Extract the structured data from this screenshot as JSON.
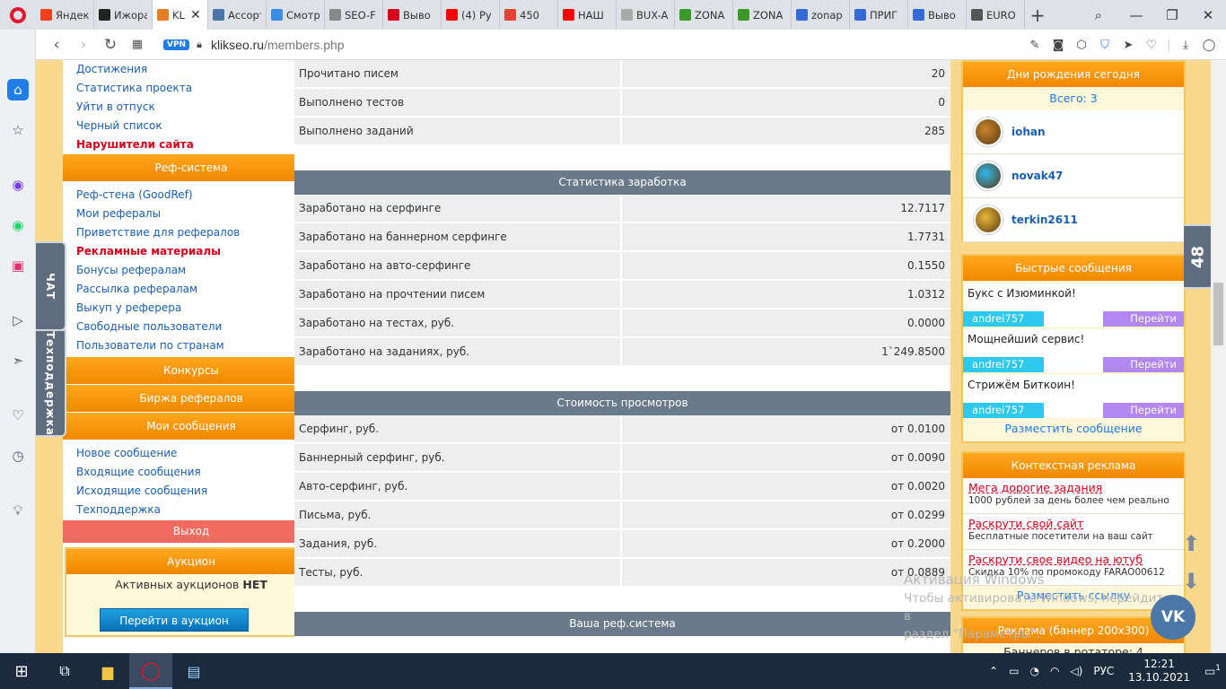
{
  "browser": {
    "tabs": [
      {
        "title": "Яндекс",
        "color": "#fc3f1d"
      },
      {
        "title": "Ижора",
        "color": "#222222"
      },
      {
        "title": "KL",
        "color": "#e67e22",
        "active": true
      },
      {
        "title": "Ассорти",
        "color": "#4a76a8"
      },
      {
        "title": "Смотр",
        "color": "#3a8de0"
      },
      {
        "title": "SEO-F",
        "color": "#888888"
      },
      {
        "title": "Выво",
        "color": "#d6001c"
      },
      {
        "title": "(4) Ру",
        "color": "#ff0000"
      },
      {
        "title": "450",
        "color": "#ef4036"
      },
      {
        "title": "НАШ",
        "color": "#ff0000"
      },
      {
        "title": "BUX-A",
        "color": "#aaaaaa"
      },
      {
        "title": "ZONA",
        "color": "#3c9a2b"
      },
      {
        "title": "ZONA",
        "color": "#3c9a2b"
      },
      {
        "title": "zonap",
        "color": "#3569d6"
      },
      {
        "title": "ПРИГ",
        "color": "#3569d6"
      },
      {
        "title": "Выво",
        "color": "#3569d6"
      },
      {
        "title": "EURO",
        "color": "#555555"
      }
    ],
    "url_host": "klikseo.ru",
    "url_path": "/members.php",
    "vpn_label": "VPN"
  },
  "left_menu": {
    "links_top": [
      "Достижения",
      "Статистика проекта",
      "Уйти в отпуск",
      "Черный список"
    ],
    "violators": "Нарушители сайта",
    "ref_header": "Реф-система",
    "ref_links": [
      "Реф-стена (GoodRef)",
      "Мои рефералы",
      "Приветствие для рефералов"
    ],
    "ref_materials": "Рекламные материалы",
    "ref_links2": [
      "Бонусы рефералам",
      "Рассылка рефералам",
      "Выкуп у реферера",
      "Свободные пользователи",
      "Пользователи по странам"
    ],
    "contests": "Конкурсы",
    "ref_exchange": "Биржа рефералов",
    "my_messages": "Мои сообщения",
    "msg_links": [
      "Новое сообщение",
      "Входящие сообщения",
      "Исходящие сообщения",
      "Техподдержка"
    ],
    "exit": "Выход",
    "auction_header": "Аукцион",
    "auction_prefix": "Активных аукционов ",
    "auction_status": "НЕТ",
    "auction_button": "Перейти в аукцион"
  },
  "side_tabs": {
    "chat": "ЧАТ",
    "support": "Техподдержка",
    "counter": "48"
  },
  "main": {
    "top_rows": [
      {
        "label": "Прочитано писем",
        "value": "20"
      },
      {
        "label": "Выполнено тестов",
        "value": "0"
      },
      {
        "label": "Выполнено заданий",
        "value": "285"
      }
    ],
    "earnings_header": "Статистика заработка",
    "earnings_rows": [
      {
        "label": "Заработано на серфинге",
        "value": "12.7117"
      },
      {
        "label": "Заработано на баннерном серфинге",
        "value": "1.7731"
      },
      {
        "label": "Заработано на авто-серфинге",
        "value": "0.1550"
      },
      {
        "label": "Заработано на прочтении писем",
        "value": "1.0312"
      },
      {
        "label": "Заработано на тестах, руб.",
        "value": "0.0000"
      },
      {
        "label": "Заработано на заданиях, руб.",
        "value": "1`249.8500"
      }
    ],
    "cost_header": "Стоимость просмотров",
    "cost_rows": [
      {
        "label": "Серфинг, руб.",
        "value": "от 0.0100"
      },
      {
        "label": "Баннерный серфинг, руб.",
        "value": "от 0.0090"
      },
      {
        "label": "Авто-серфинг, руб.",
        "value": "от 0.0020"
      },
      {
        "label": "Письма, руб.",
        "value": "от 0.0299"
      },
      {
        "label": "Задания, руб.",
        "value": "от 0.2000"
      },
      {
        "label": "Тесты, руб.",
        "value": "от 0.0889"
      }
    ],
    "ref_header": "Ваша реф.система"
  },
  "right": {
    "birthdays_header": "Дни рождения сегодня",
    "birthdays_total": "Всего: 3",
    "birthdays": [
      "iohan",
      "novak47",
      "terkin2611"
    ],
    "quick_header": "Быстрые сообщения",
    "quick_messages": [
      {
        "text": "Букс с Изюминкой!",
        "user": "andrei757",
        "go": "Перейти"
      },
      {
        "text": "Мощнейший сервис!",
        "user": "andrei757",
        "go": "Перейти"
      },
      {
        "text": "Стрижём Биткоин!",
        "user": "andrei757",
        "go": "Перейти"
      }
    ],
    "post_message": "Разместить сообщение",
    "context_header": "Контекстная реклама",
    "context_ads": [
      {
        "title": "Мега дорогие задания",
        "desc": "1000 рублей за день более чем реально"
      },
      {
        "title": "Раскрути свой сайт",
        "desc": "Бесплатные посетители на ваш сайт"
      },
      {
        "title": "Раскрути свое видео на ютуб",
        "desc": "Скидка 10% по промокоду FARAO00612"
      }
    ],
    "post_link": "Разместить ссылку",
    "banner_header": "Реклама (баннер 200x300)",
    "banner_rotator": "Баннеров в ротаторе: 4"
  },
  "overlay": {
    "activate_line1": "Активация Windows",
    "activate_line2": "Чтобы активировать Windows, перейдите в",
    "activate_line3": "раздел \"Параметры\".",
    "vk": "VK"
  },
  "taskbar": {
    "lang": "РУС",
    "time": "12:21",
    "date": "13.10.2021",
    "notif_count": "1"
  }
}
